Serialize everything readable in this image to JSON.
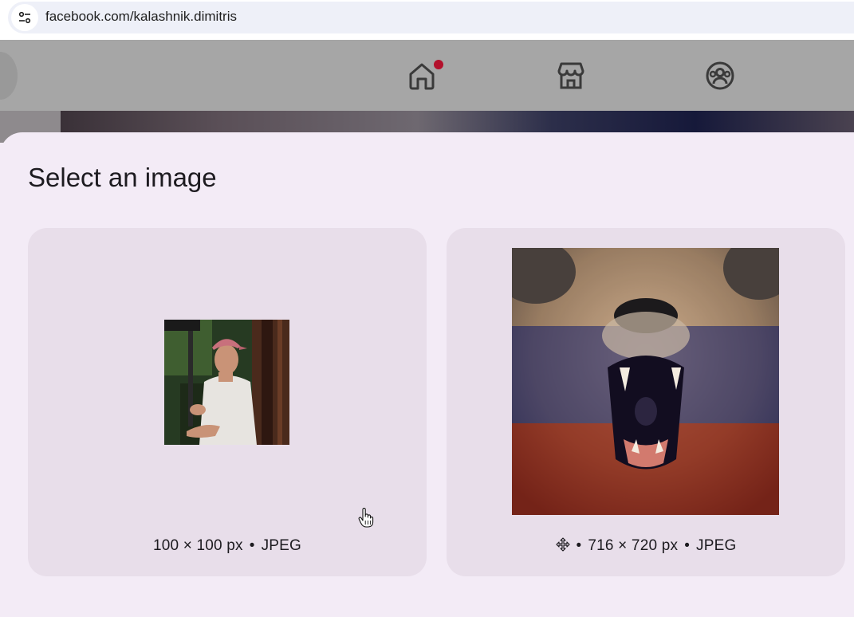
{
  "browser": {
    "url": "facebook.com/kalashnik.dimitris",
    "site_info_icon": "tune-icon"
  },
  "fb_nav": {
    "icons": [
      "home-icon",
      "marketplace-icon",
      "groups-icon"
    ],
    "home_has_notification": true,
    "notification_color": "#b3102b"
  },
  "dialog": {
    "title": "Select an image",
    "images": [
      {
        "dimensions": "100 × 100 px",
        "format": "JPEG",
        "separator": "•",
        "subject": "man in pink cap"
      },
      {
        "drag_icon": "move-icon",
        "dimensions": "716 × 720 px",
        "format": "JPEG",
        "separator": "•",
        "subject": "roaring bear with flag overlay"
      }
    ]
  },
  "colors": {
    "sheet_background": "#f3ebf6",
    "card_background": "#e8deea",
    "text": "#1d1b20"
  }
}
